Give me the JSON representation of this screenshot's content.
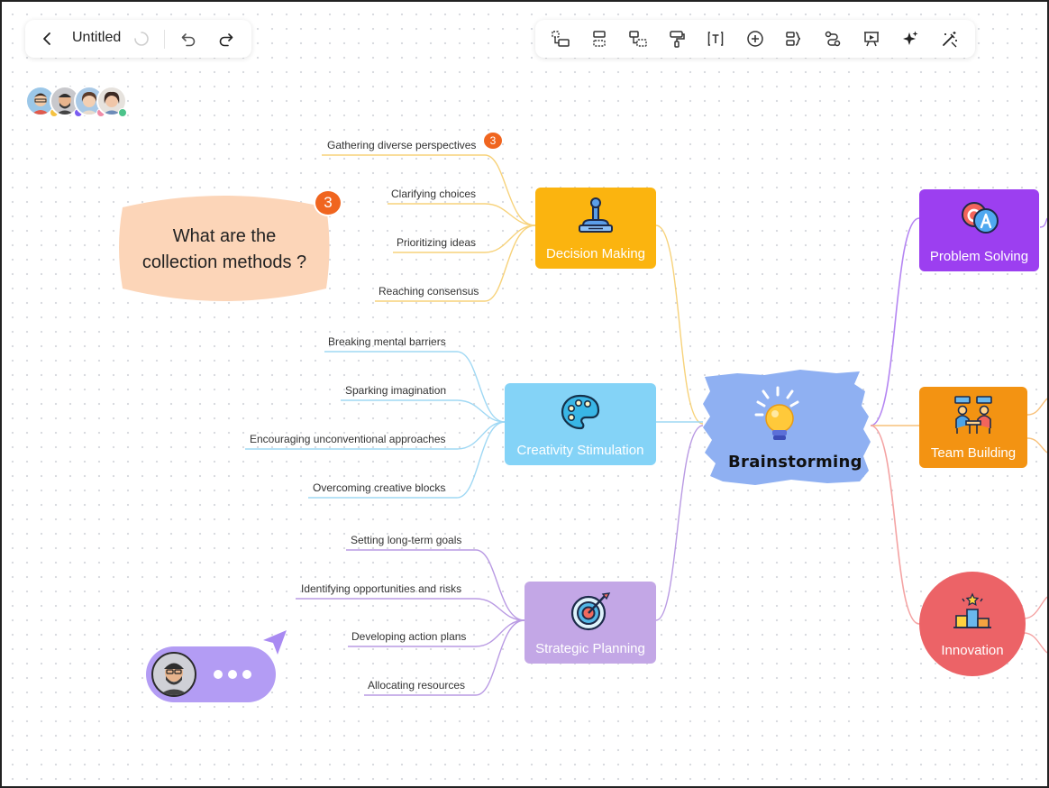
{
  "app": {
    "title": "Untitled",
    "toolbar_left": [
      {
        "name": "back-icon"
      },
      {
        "name": "loading-spinner-icon"
      },
      {
        "name": "undo-icon"
      },
      {
        "name": "redo-icon"
      }
    ],
    "toolbar_right": [
      {
        "name": "insert-subtopic-icon"
      },
      {
        "name": "insert-sibling-icon"
      },
      {
        "name": "insert-parent-icon"
      },
      {
        "name": "format-painter-icon"
      },
      {
        "name": "text-box-icon"
      },
      {
        "name": "add-icon"
      },
      {
        "name": "summary-icon"
      },
      {
        "name": "relationship-icon"
      },
      {
        "name": "presentation-icon"
      },
      {
        "name": "ai-sparkle-icon"
      },
      {
        "name": "magic-wand-icon"
      }
    ],
    "collaborators": [
      {
        "name": "collaborator-1",
        "status_color": "#f5c242"
      },
      {
        "name": "collaborator-2",
        "status_color": "#7a5cf0"
      },
      {
        "name": "collaborator-3",
        "status_color": "#f08aa5"
      },
      {
        "name": "collaborator-4",
        "status_color": "#4cc38a"
      }
    ]
  },
  "mindmap": {
    "center": {
      "label": "Brainstorming",
      "color": "#8fb0f2",
      "icon": "lightbulb-icon"
    },
    "branches": [
      {
        "label": "Decision Making",
        "color": "#fbb40f",
        "icon": "stamp-icon",
        "badge": "3",
        "children": [
          "Gathering diverse perspectives",
          "Clarifying choices",
          "Prioritizing ideas",
          "Reaching consensus"
        ]
      },
      {
        "label": "Creativity Stimulation",
        "color": "#84d3f7",
        "icon": "palette-icon",
        "children": [
          "Breaking mental barriers",
          "Sparking imagination",
          "Encouraging unconventional approaches",
          "Overcoming creative blocks"
        ]
      },
      {
        "label": "Strategic Planning",
        "color": "#c3a7e6",
        "icon": "target-icon",
        "children": [
          "Setting long-term goals",
          "Identifying opportunities and risks",
          "Developing action plans",
          "Allocating resources"
        ]
      },
      {
        "label": "Problem Solving",
        "color": "#9c3ff0",
        "icon": "chat-bubbles-icon"
      },
      {
        "label": "Team Building",
        "color": "#f39312",
        "icon": "team-meeting-icon"
      },
      {
        "label": "Innovation",
        "color": "#ec6367",
        "icon": "podium-icon"
      }
    ]
  },
  "comment": {
    "text_line1": "What are the",
    "text_line2": "collection methods ?",
    "badge": "3",
    "color": "#fcd5b8"
  },
  "chat": {
    "status": "typing",
    "color": "#b39cf4"
  }
}
